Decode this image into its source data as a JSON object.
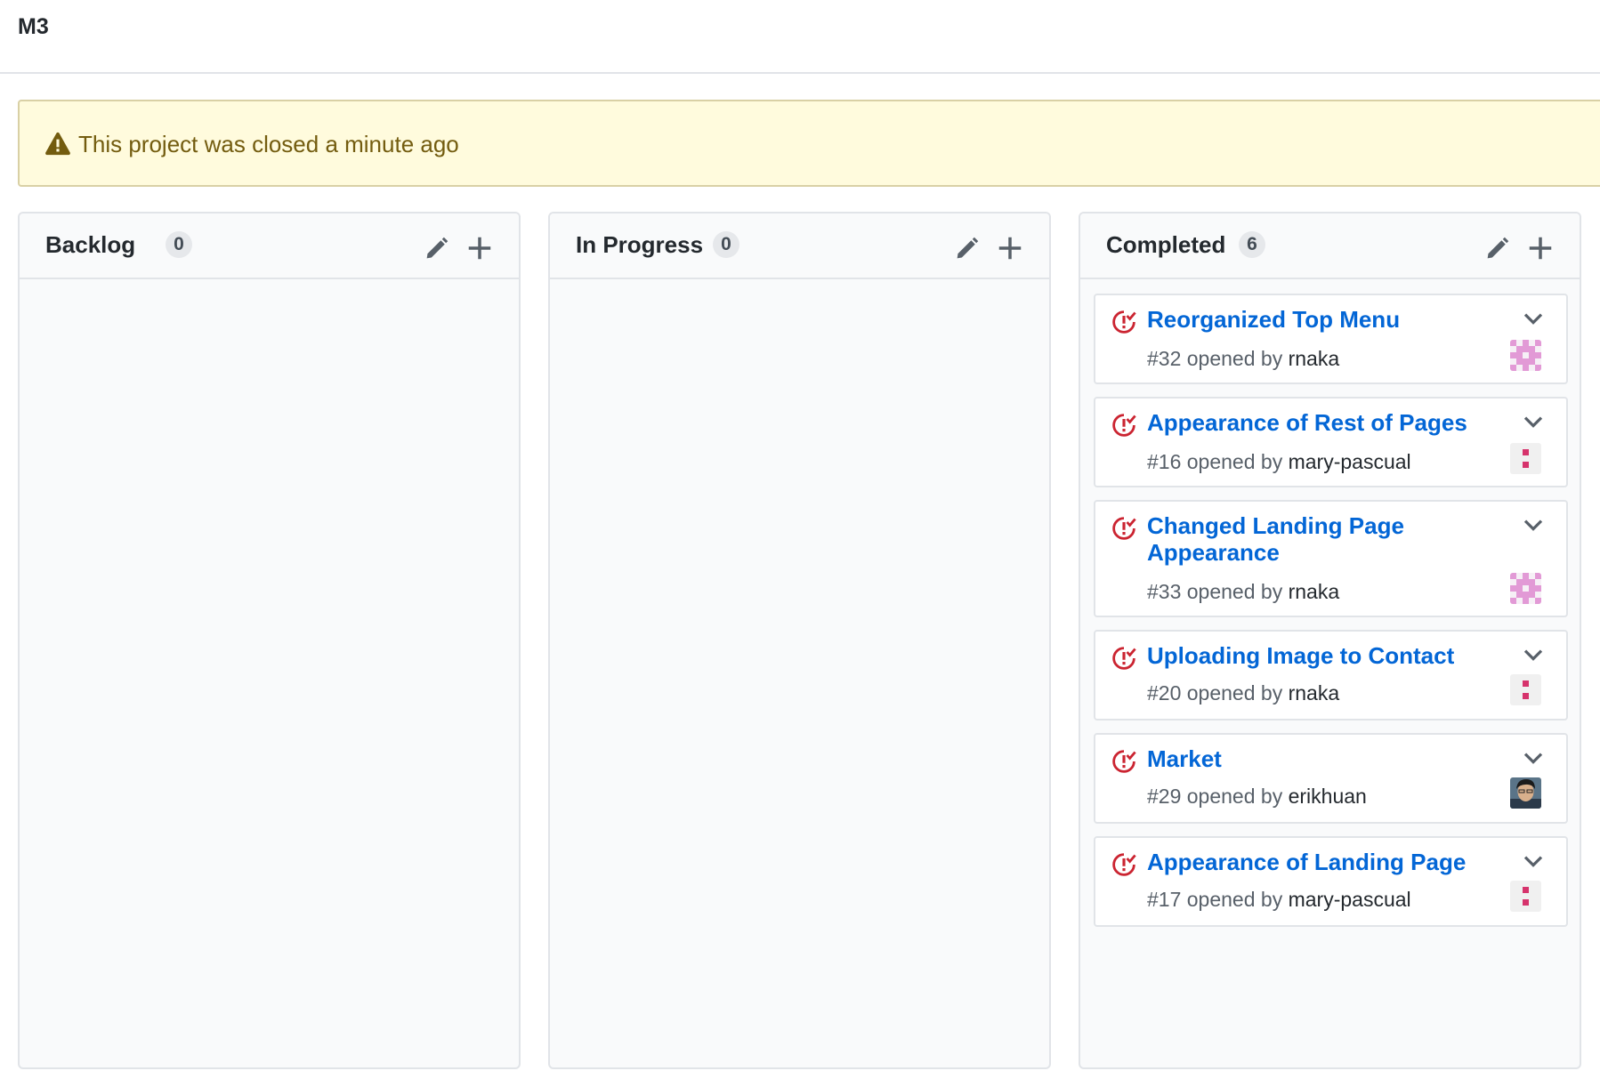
{
  "project": {
    "title": "M3"
  },
  "flash": {
    "message": "This project was closed a minute ago"
  },
  "columns": [
    {
      "name": "Backlog",
      "count": "0"
    },
    {
      "name": "In Progress",
      "count": "0"
    },
    {
      "name": "Completed",
      "count": "6",
      "cards": [
        {
          "title": "Reorganized Top Menu",
          "number": "#32",
          "opened_by": "opened by",
          "author": "rnaka",
          "avatar": "identicon-pink"
        },
        {
          "title": "Appearance of Rest of Pages",
          "number": "#16",
          "opened_by": "opened by",
          "author": "mary-pascual",
          "avatar": "identicon-red"
        },
        {
          "title": "Changed Landing Page Appearance",
          "number": "#33",
          "opened_by": "opened by",
          "author": "rnaka",
          "avatar": "identicon-pink"
        },
        {
          "title": "Uploading Image to Contact",
          "number": "#20",
          "opened_by": "opened by",
          "author": "rnaka",
          "avatar": "identicon-red"
        },
        {
          "title": "Market",
          "number": "#29",
          "opened_by": "opened by",
          "author": "erikhuan",
          "avatar": "photo"
        },
        {
          "title": "Appearance of Landing Page",
          "number": "#17",
          "opened_by": "opened by",
          "author": "mary-pascual",
          "avatar": "identicon-red"
        }
      ]
    }
  ],
  "icons": {
    "flash": "alert-icon",
    "column_edit": "pencil-icon",
    "column_add": "plus-icon",
    "card_state": "issue-closed-icon",
    "card_menu": "chevron-down-icon"
  },
  "colors": {
    "link": "#0366d6",
    "closed_issue": "#cb2431",
    "flash_bg": "#fffbdd",
    "flash_text": "#735c0f",
    "column_bg": "#f9fafb"
  }
}
